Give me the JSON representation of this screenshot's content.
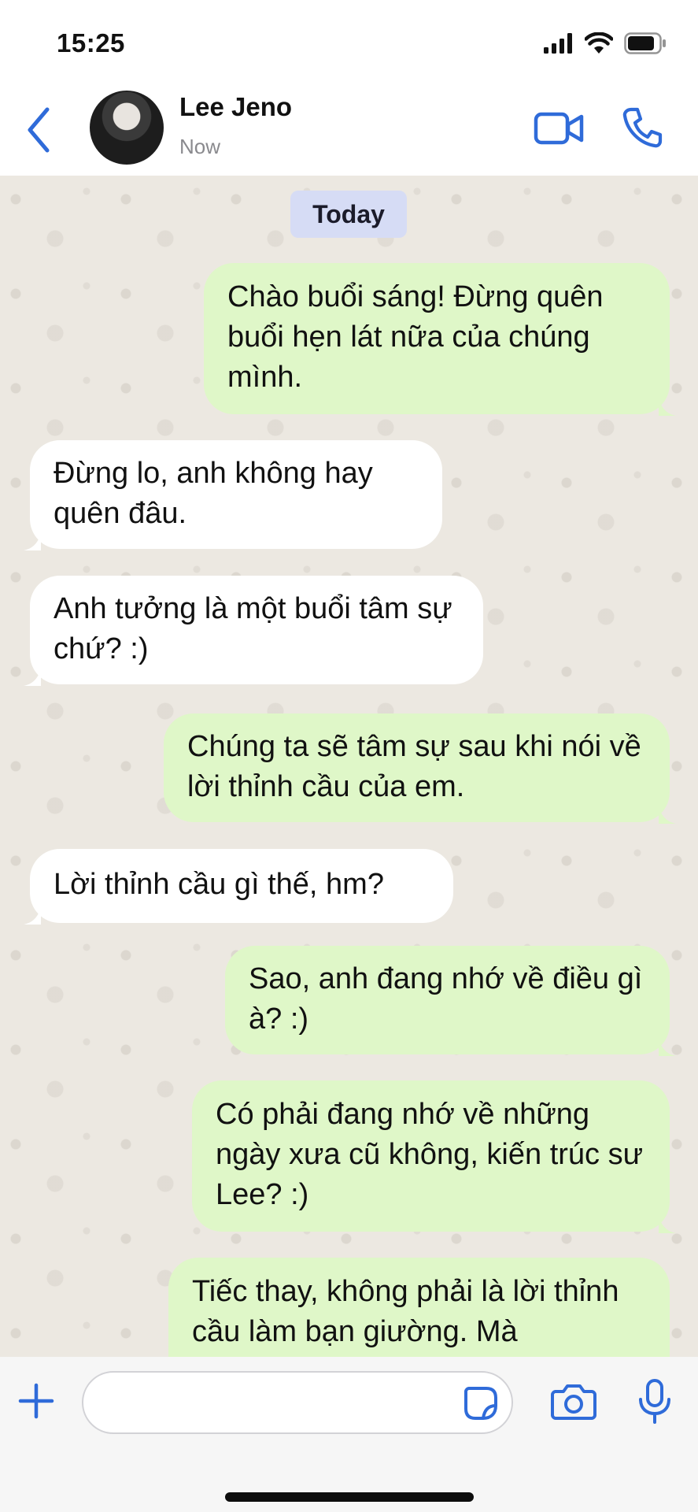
{
  "status_bar": {
    "time": "15:25",
    "icons": [
      "signal-icon",
      "wifi-icon",
      "battery-icon"
    ]
  },
  "header": {
    "contact_name": "Lee Jeno",
    "presence": "Now"
  },
  "chat": {
    "date_label": "Today",
    "messages": [
      {
        "direction": "outgoing",
        "text": "Chào buổi sáng! Đừng quên buổi hẹn lát nữa của chúng mình."
      },
      {
        "direction": "incoming",
        "text": "Đừng lo, anh không hay quên đâu."
      },
      {
        "direction": "incoming",
        "text": "Anh tưởng là một buổi tâm sự chứ? :)"
      },
      {
        "direction": "outgoing",
        "text": "Chúng ta sẽ tâm sự sau khi nói về lời thỉnh cầu của em."
      },
      {
        "direction": "incoming",
        "text": "Lời thỉnh cầu gì thế, hm?"
      },
      {
        "direction": "outgoing",
        "text": "Sao, anh đang nhớ về điều gì à? :)"
      },
      {
        "direction": "outgoing",
        "text": "Có phải đang nhớ về những ngày xưa cũ không, kiến trúc sư Lee? :)"
      },
      {
        "direction": "outgoing",
        "text": "Tiếc thay, không phải là lời thỉnh cầu làm bạn giường. Mà"
      }
    ]
  },
  "input_bar": {
    "placeholder": ""
  },
  "colors": {
    "accent": "#2f6bd9",
    "outgoing_bubble": "#dff7c8",
    "incoming_bubble": "#ffffff",
    "chat_background": "#ece8e1",
    "date_chip": "#d6dcf5"
  }
}
